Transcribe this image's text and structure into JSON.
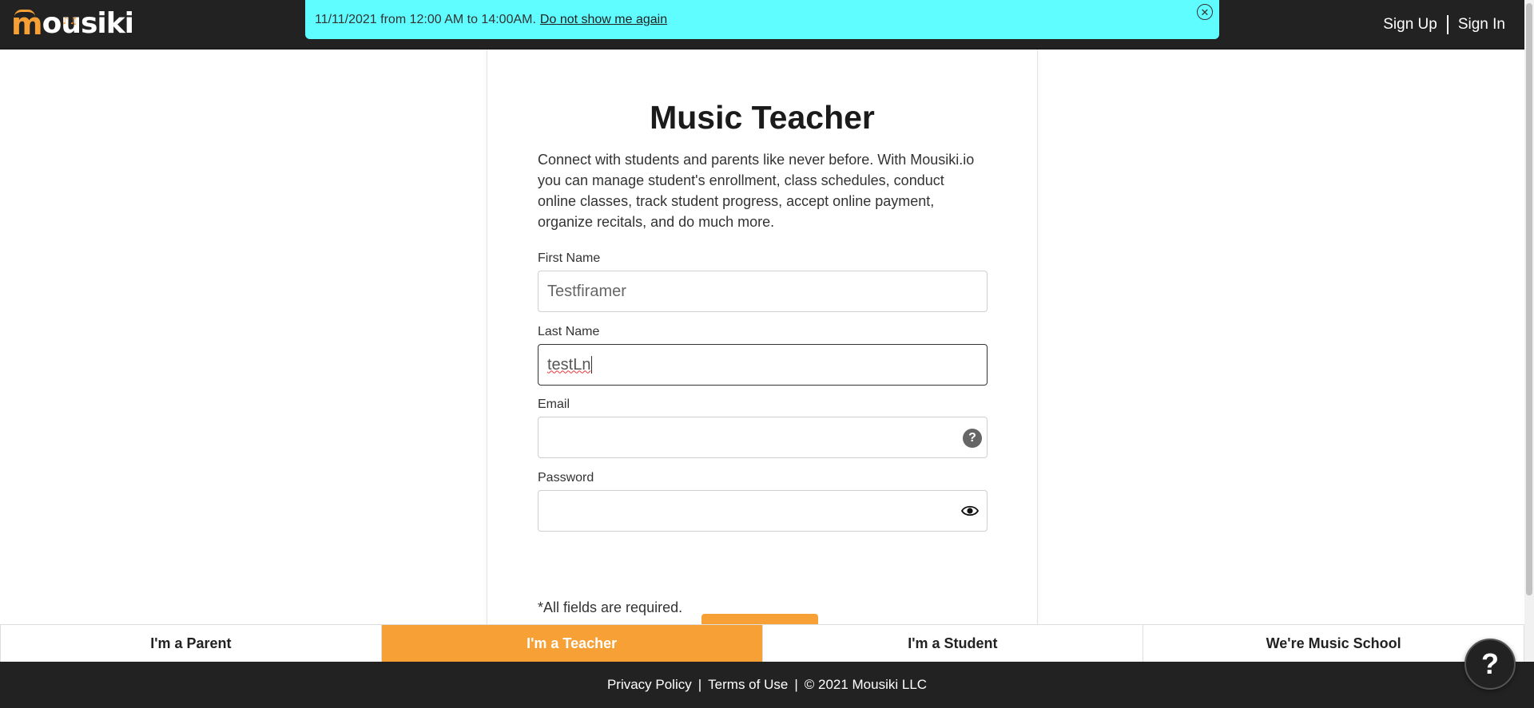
{
  "header": {
    "logo_text": "Mousiki",
    "sign_up": "Sign Up",
    "sign_in": "Sign In"
  },
  "banner": {
    "message": "11/11/2021 from 12:00 AM to 14:00AM.",
    "dismiss_link": "Do not show me again",
    "close_icon": "⊗"
  },
  "form": {
    "title": "Music Teacher",
    "intro": "Connect with students and parents like never before. With Mousiki.io you can manage student's enrollment, class schedules, conduct online classes, track student progress, accept online payment, organize recitals, and do much more.",
    "first_name_label": "First Name",
    "first_name_value": "Testfiramer",
    "last_name_label": "Last Name",
    "last_name_value": "testLn",
    "email_label": "Email",
    "email_value": "",
    "email_help_icon": "?",
    "password_label": "Password",
    "password_value": "",
    "required_note": "*All fields are required."
  },
  "role_tabs": [
    {
      "label": "I'm a Parent",
      "active": false
    },
    {
      "label": "I'm a Teacher",
      "active": true
    },
    {
      "label": "I'm a Student",
      "active": false
    },
    {
      "label": "We're Music School",
      "active": false
    }
  ],
  "footer": {
    "privacy": "Privacy Policy",
    "terms": "Terms of Use",
    "copyright": "© 2021 Mousiki LLC",
    "separator": "|"
  },
  "help_button": "?",
  "colors": {
    "accent": "#f7a035",
    "topbar": "#222222",
    "banner": "#5ffdff"
  }
}
